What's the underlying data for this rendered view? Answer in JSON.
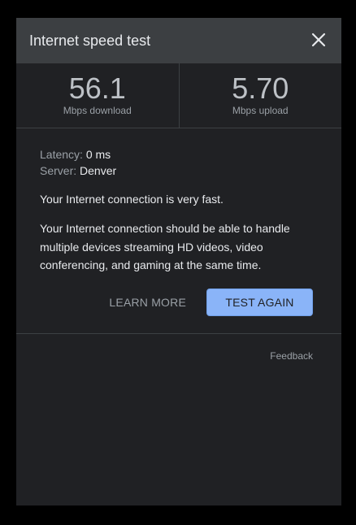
{
  "header": {
    "title": "Internet speed test",
    "close_icon": "close-icon"
  },
  "results": {
    "download": {
      "value": "56.1",
      "unit": "Mbps download"
    },
    "upload": {
      "value": "5.70",
      "unit": "Mbps upload"
    }
  },
  "info": {
    "latency_label": "Latency:",
    "latency_value": "0 ms",
    "server_label": "Server:",
    "server_value": "Denver"
  },
  "verdict": "Your Internet connection is very fast.",
  "detail": "Your Internet connection should be able to handle multiple devices streaming HD videos, video conferencing, and gaming at the same time.",
  "actions": {
    "learn_more": "LEARN MORE",
    "test_again": "TEST AGAIN"
  },
  "feedback": "Feedback",
  "colors": {
    "accent": "#8ab4f8",
    "header_bg": "#3c3f42",
    "panel_bg": "#202124"
  }
}
